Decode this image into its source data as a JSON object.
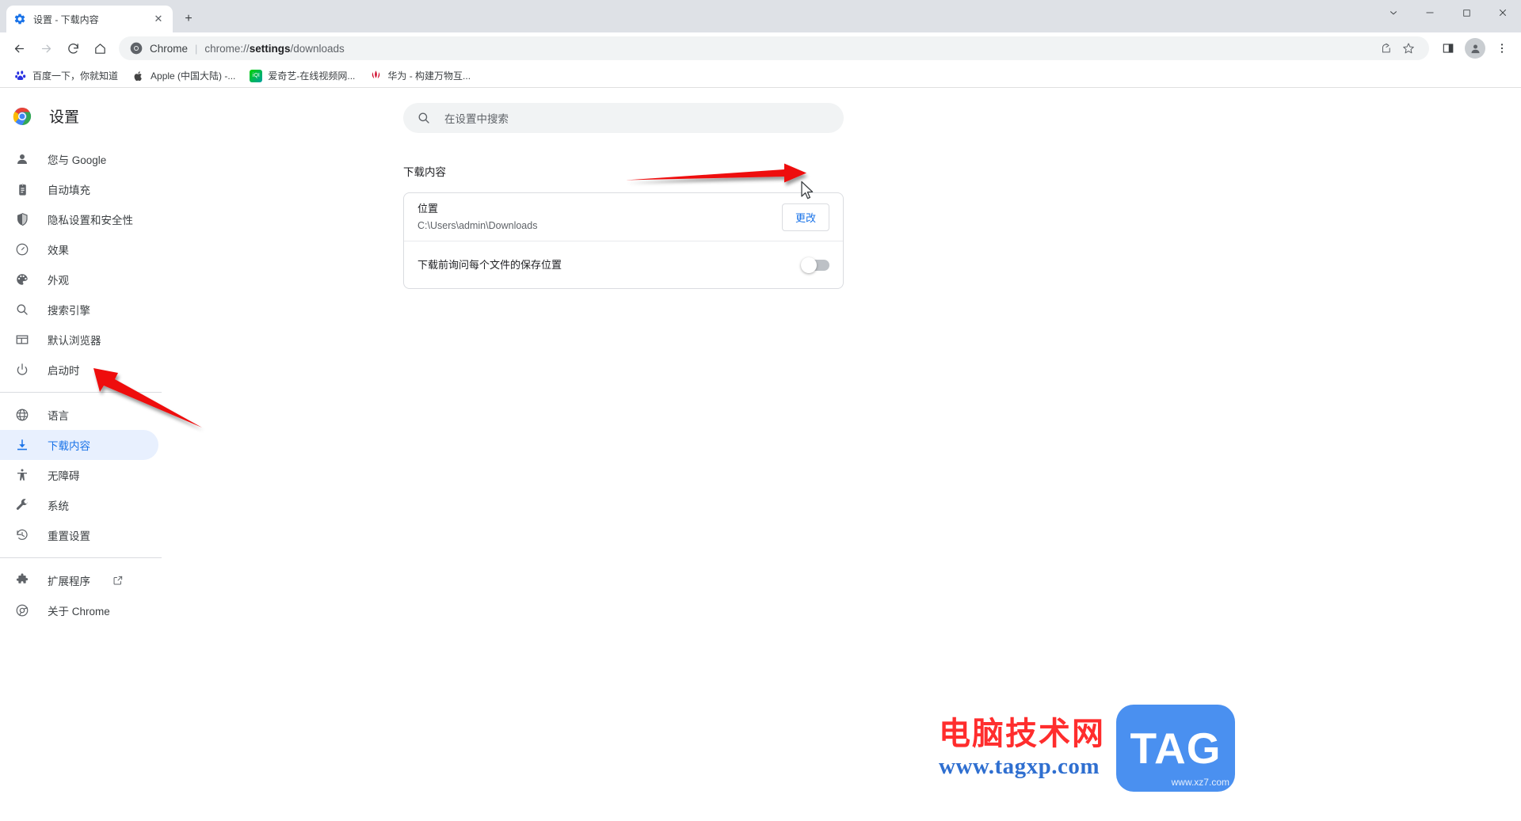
{
  "window": {
    "controls": [
      {
        "name": "tab-search",
        "glyph": "⌄"
      },
      {
        "name": "minimize",
        "glyph": "—"
      },
      {
        "name": "maximize",
        "glyph": "☐"
      },
      {
        "name": "close",
        "glyph": "✕"
      }
    ]
  },
  "tab": {
    "title": "设置 - 下载内容",
    "close_glyph": "✕",
    "newtab_glyph": "+"
  },
  "toolbar": {
    "back_glyph": "←",
    "forward_glyph": "→",
    "reload_glyph": "⟳",
    "home_glyph": "⌂",
    "omnibox": {
      "scheme_label": "Chrome",
      "separator": "|",
      "url_prefix": "chrome://",
      "url_bold": "settings",
      "url_suffix": "/downloads"
    },
    "right_icons": [
      {
        "name": "share-icon",
        "glyph": "↪"
      },
      {
        "name": "bookmark-star-icon",
        "glyph": "☆"
      },
      {
        "name": "side-panel-icon",
        "glyph": "▧"
      }
    ],
    "menu_glyph": "⋮"
  },
  "bookmarks": [
    {
      "label": "百度一下，你就知道",
      "icon": "baidu-icon",
      "color": "#2932e1",
      "letter": "百"
    },
    {
      "label": "Apple (中国大陆) -...",
      "icon": "apple-icon",
      "color": "#555555",
      "letter": ""
    },
    {
      "label": "爱奇艺-在线视频网...",
      "icon": "iqiyi-icon",
      "color": "#00be06",
      "letter": "iQI"
    },
    {
      "label": "华为 - 构建万物互...",
      "icon": "huawei-icon",
      "color": "#cf0a2c",
      "letter": "华"
    }
  ],
  "sidebar": {
    "brand": "设置",
    "brand_icon": "chrome-logo-icon",
    "groups": [
      {
        "items": [
          {
            "label": "您与 Google",
            "icon": "person-icon",
            "active": false
          },
          {
            "label": "自动填充",
            "icon": "clipboard-icon",
            "active": false
          },
          {
            "label": "隐私设置和安全性",
            "icon": "shield-icon",
            "active": false
          },
          {
            "label": "效果",
            "icon": "speedometer-icon",
            "active": false
          },
          {
            "label": "外观",
            "icon": "palette-icon",
            "active": false
          },
          {
            "label": "搜索引擎",
            "icon": "search-icon",
            "active": false
          },
          {
            "label": "默认浏览器",
            "icon": "browser-window-icon",
            "active": false
          },
          {
            "label": "启动时",
            "icon": "power-icon",
            "active": false
          }
        ]
      },
      {
        "items": [
          {
            "label": "语言",
            "icon": "globe-icon",
            "active": false
          },
          {
            "label": "下载内容",
            "icon": "download-icon",
            "active": true
          },
          {
            "label": "无障碍",
            "icon": "accessibility-icon",
            "active": false
          },
          {
            "label": "系统",
            "icon": "wrench-icon",
            "active": false
          },
          {
            "label": "重置设置",
            "icon": "history-restore-icon",
            "active": false
          }
        ]
      },
      {
        "items": [
          {
            "label": "扩展程序",
            "icon": "puzzle-icon",
            "active": false,
            "external": true
          },
          {
            "label": "关于 Chrome",
            "icon": "chrome-outline-icon",
            "active": false
          }
        ]
      }
    ]
  },
  "search": {
    "placeholder": "在设置中搜索",
    "icon": "search-icon"
  },
  "main": {
    "section_title": "下载内容",
    "rows": [
      {
        "title": "位置",
        "subtitle": "C:\\Users\\admin\\Downloads",
        "button_label": "更改"
      },
      {
        "title": "下载前询问每个文件的保存位置",
        "toggle_on": false
      }
    ]
  },
  "annotations": {
    "arrow_color": "#ee1111",
    "arrows": [
      {
        "name": "arrow-to-change-button"
      },
      {
        "name": "arrow-to-downloads-nav"
      }
    ],
    "cursor": "mouse-pointer"
  },
  "watermark": {
    "cn_text": "电脑技术网",
    "url_text": "www.tagxp.com",
    "badge_text": "TAG",
    "badge_sub": "www.xz7.com",
    "cn_color": "#ff2d2d",
    "url_color": "#2f6fd0",
    "badge_color": "#4a90f0"
  }
}
